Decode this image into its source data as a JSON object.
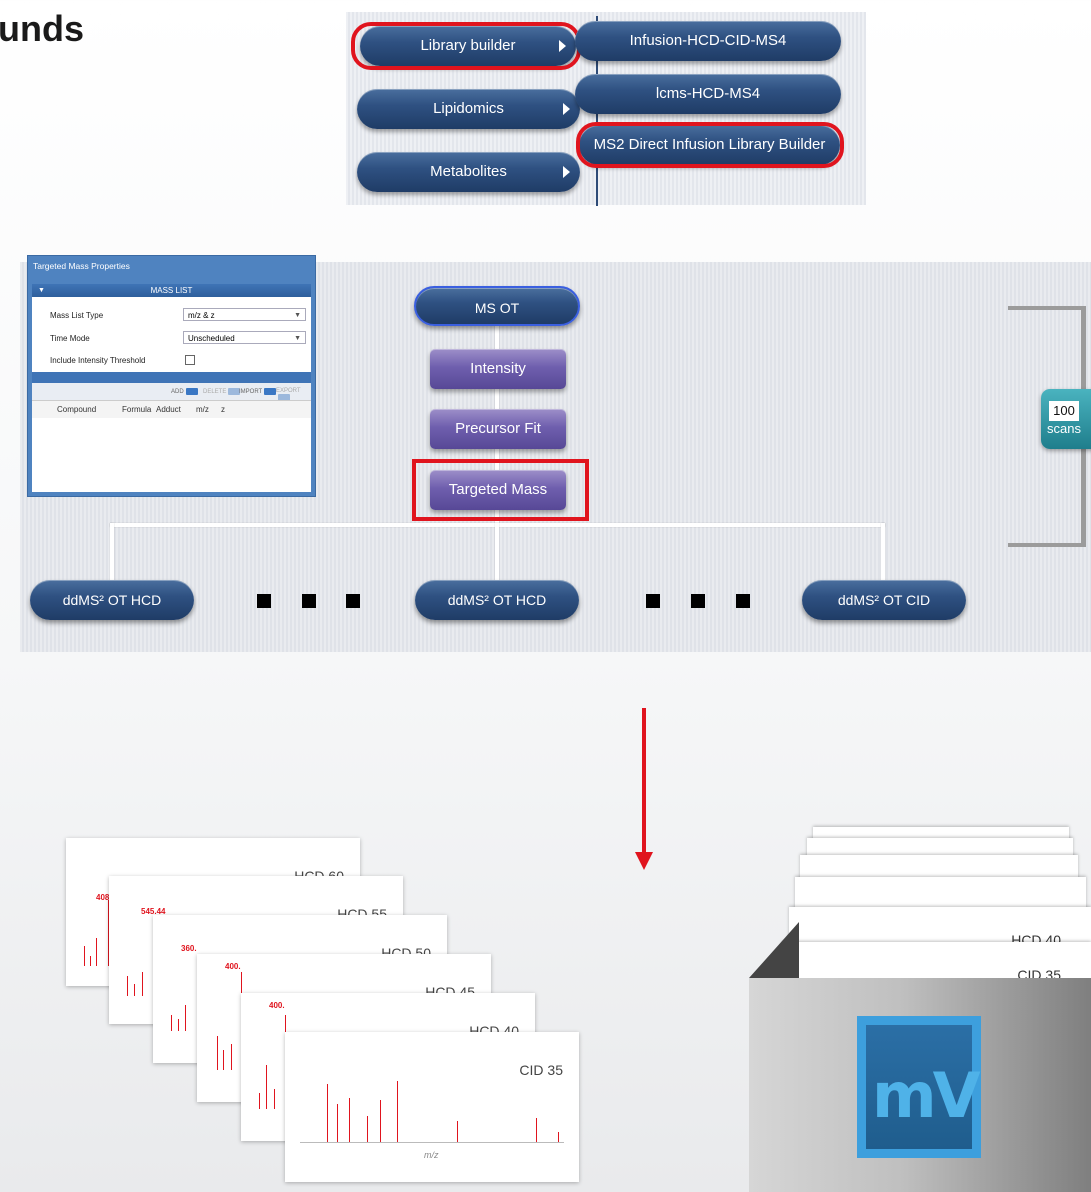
{
  "heading": "unds",
  "menu": {
    "left_items": [
      {
        "label": "Library builder",
        "highlighted": true
      },
      {
        "label": "Lipidomics",
        "highlighted": false
      },
      {
        "label": "Metabolites",
        "highlighted": false
      }
    ],
    "right_items": [
      {
        "label": "Infusion-HCD-CID-MS4",
        "highlighted": false
      },
      {
        "label": "lcms-HCD-MS4",
        "highlighted": false
      },
      {
        "label": "MS2 Direct Infusion Library Builder",
        "highlighted": true
      }
    ]
  },
  "properties": {
    "title": "Targeted Mass Properties",
    "section": "MASS LIST",
    "rows": [
      {
        "label": "Mass List Type",
        "value": "m/z & z"
      },
      {
        "label": "Time Mode",
        "value": "Unscheduled"
      },
      {
        "label": "Include Intensity Threshold",
        "value": ""
      }
    ],
    "toolbar": [
      "ADD",
      "DELETE",
      "IMPORT",
      "EXPORT"
    ],
    "columns": [
      "Compound",
      "Formula",
      "Adduct",
      "m/z",
      "z"
    ]
  },
  "workflow": {
    "root": "MS OT",
    "steps": [
      "Intensity",
      "Precursor Fit",
      "Targeted Mass"
    ],
    "outputs": [
      "ddMS² OT HCD",
      "ddMS² OT HCD",
      "ddMS² OT CID"
    ],
    "scans": {
      "value": "100",
      "unit": "scans"
    }
  },
  "spectra": [
    {
      "label": "HCD 60",
      "peak": "408"
    },
    {
      "label": "HCD 55",
      "peak": "545.44"
    },
    {
      "label": "HCD 50",
      "peak": "360."
    },
    {
      "label": "HCD 45",
      "peak": "400."
    },
    {
      "label": "HCD 40",
      "peak": "400."
    },
    {
      "label": "CID 35",
      "peak": ""
    }
  ],
  "spectrum_axis": "m/z",
  "library_cards": [
    "HCD 40",
    "CID 35"
  ],
  "logo_text": "mV",
  "colors": {
    "highlight": "#e0141e",
    "pill": "#2f5182",
    "step": "#6f5fae"
  }
}
